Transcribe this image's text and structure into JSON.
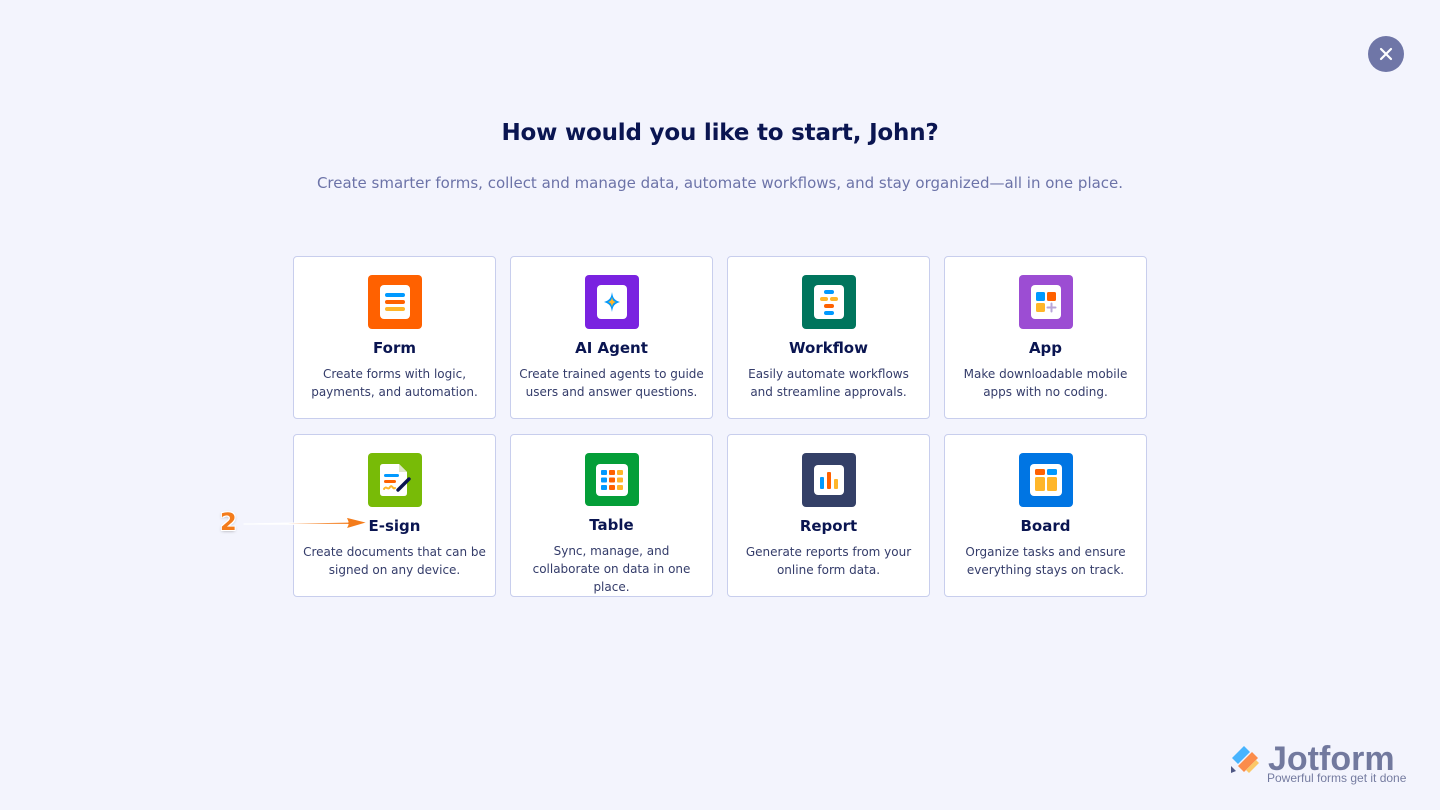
{
  "header": {
    "title": "How would you like to start, John?",
    "subtitle": "Create smarter forms, collect and manage data, automate workflows, and stay organized—all in one place."
  },
  "close_button": {
    "icon": "close-icon"
  },
  "options": [
    {
      "title": "Form",
      "description": "Create forms with logic, payments, and automation.",
      "icon": "form-icon",
      "color": "#ff6100"
    },
    {
      "title": "AI Agent",
      "description": "Create trained agents to guide users and answer questions.",
      "icon": "ai-agent-icon",
      "color": "#7a22e0"
    },
    {
      "title": "Workflow",
      "description": "Easily automate workflows and streamline approvals.",
      "icon": "workflow-icon",
      "color": "#00755d"
    },
    {
      "title": "App",
      "description": "Make downloadable mobile apps with no coding.",
      "icon": "app-icon",
      "color": "#9c4dd3"
    },
    {
      "title": "E-sign",
      "description": "Create documents that can be signed on any device.",
      "icon": "esign-icon",
      "color": "#78bb07"
    },
    {
      "title": "Table",
      "description": "Sync, manage, and collaborate on data in one place.",
      "icon": "table-icon",
      "color": "#049e38"
    },
    {
      "title": "Report",
      "description": "Generate reports from your online form data.",
      "icon": "report-icon",
      "color": "#344067"
    },
    {
      "title": "Board",
      "description": "Organize tasks and ensure everything stays on track.",
      "icon": "board-icon",
      "color": "#0075e3"
    }
  ],
  "annotation": {
    "step": "2",
    "color": "#f47c1b"
  },
  "branding": {
    "name": "Jotform",
    "tagline": "Powerful forms get it done"
  }
}
